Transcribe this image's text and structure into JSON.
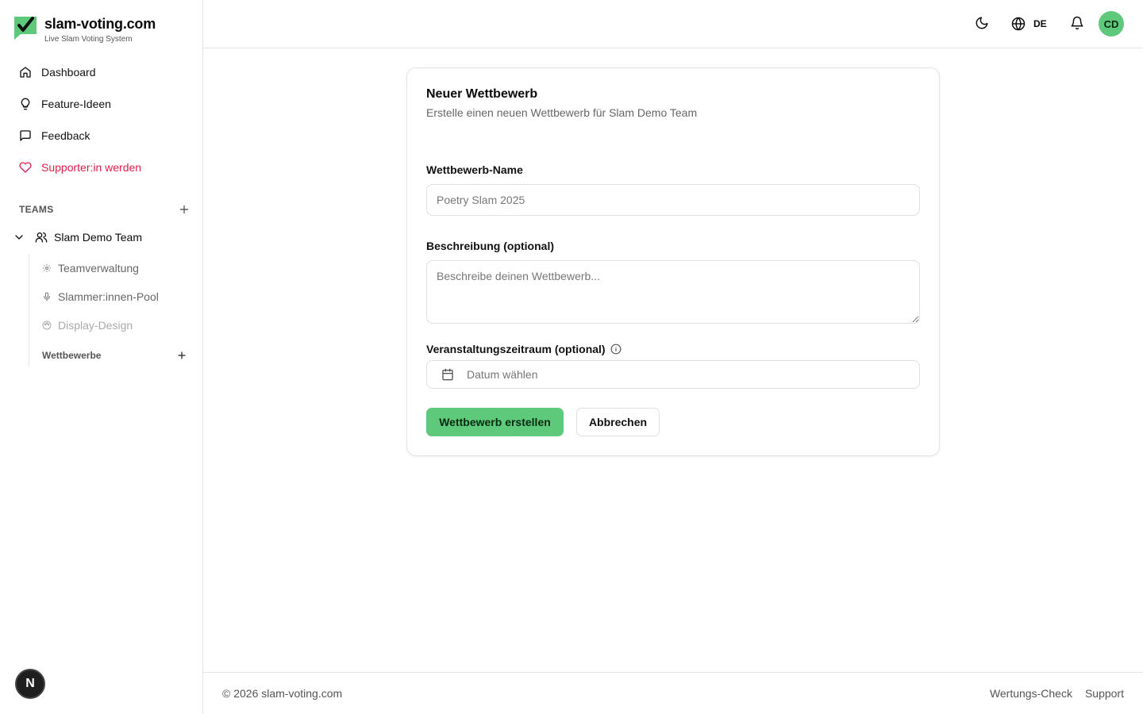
{
  "brand": {
    "title": "slam-voting.com",
    "subtitle": "Live Slam Voting System",
    "accent": "#5ec97b"
  },
  "nav": [
    {
      "label": "Dashboard",
      "icon": "home-icon"
    },
    {
      "label": "Feature-Ideen",
      "icon": "lightbulb-icon"
    },
    {
      "label": "Feedback",
      "icon": "message-square-icon"
    },
    {
      "label": "Supporter:in werden",
      "icon": "heart-icon",
      "color": "#e11d48"
    }
  ],
  "teams": {
    "label": "TEAMS",
    "team_name": "Slam Demo Team",
    "sub_items": [
      {
        "label": "Teamverwaltung",
        "icon": "gear-icon"
      },
      {
        "label": "Slammer:innen-Pool",
        "icon": "microphone-icon"
      },
      {
        "label": "Display-Design",
        "icon": "palette-icon"
      }
    ],
    "competitions_label": "Wettbewerbe"
  },
  "topbar": {
    "language": "DE",
    "avatar_initials": "CD"
  },
  "form": {
    "title": "Neuer Wettbewerb",
    "description": "Erstelle einen neuen Wettbewerb für Slam Demo Team",
    "name_label": "Wettbewerb-Name",
    "name_placeholder": "Poetry Slam 2025",
    "desc_label": "Beschreibung (optional)",
    "desc_placeholder": "Beschreibe deinen Wettbewerb...",
    "date_label": "Veranstaltungszeitraum (optional)",
    "date_placeholder": "Datum wählen",
    "submit_label": "Wettbewerb erstellen",
    "cancel_label": "Abbrechen"
  },
  "footer": {
    "copyright": "© 2026 slam-voting.com",
    "links": [
      "Wertungs-Check",
      "Support"
    ]
  },
  "dev_badge": "N"
}
